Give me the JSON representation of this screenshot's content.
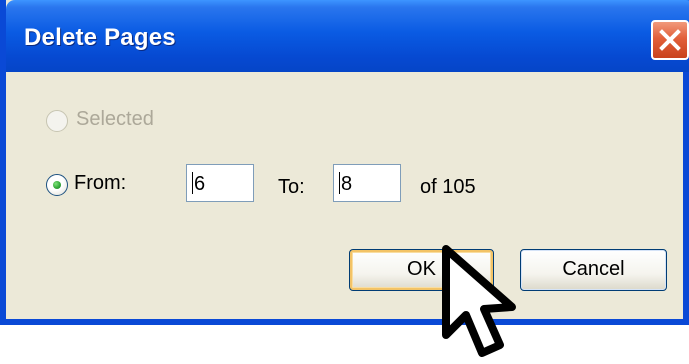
{
  "dialog": {
    "title": "Delete Pages",
    "close_icon": "close-x-icon",
    "colors": {
      "titlebar": "#0A5BE3",
      "frame": "#0A49D6",
      "body": "#ECE9D8",
      "close_button": "#E2603A",
      "disabled_text": "#ACA899"
    }
  },
  "options": {
    "selected": {
      "label": "Selected",
      "enabled": false,
      "checked": false
    },
    "from_range": {
      "label": "From:",
      "enabled": true,
      "checked": true
    }
  },
  "range": {
    "from_value": "6",
    "to_label": "To:",
    "to_value": "8",
    "total_text": "of 105"
  },
  "buttons": {
    "ok_label": "OK",
    "cancel_label": "Cancel"
  },
  "cursor": {
    "icon": "arrow-pointer-icon"
  }
}
